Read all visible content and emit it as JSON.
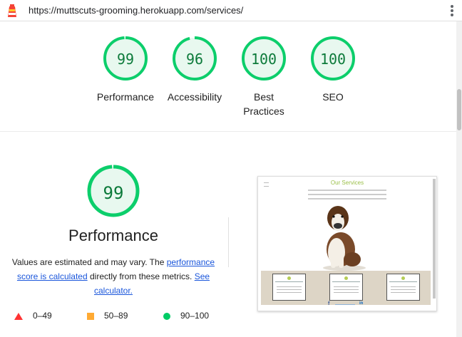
{
  "browser": {
    "url": "https://muttscuts-grooming.herokuapp.com/services/"
  },
  "colors": {
    "pass_green": "#0cce6b",
    "pass_text": "#0c7a3a",
    "pass_fill": "#e8f8ef",
    "fail_red": "#ff3333",
    "average_orange": "#ffaa33",
    "link_blue": "#1a56db"
  },
  "gauges": [
    {
      "label": "Performance",
      "score": "99",
      "value": 0.99
    },
    {
      "label": "Accessibility",
      "score": "96",
      "value": 0.96
    },
    {
      "label_line1": "Best",
      "label_line2": "Practices",
      "score": "100",
      "value": 1.0
    },
    {
      "label": "SEO",
      "score": "100",
      "value": 1.0
    }
  ],
  "performance": {
    "score": "99",
    "value": 0.99,
    "title": "Performance",
    "desc_prefix": "Values are estimated and may vary. The ",
    "desc_link1": "performance score is calculated",
    "desc_mid": " directly from these metrics. ",
    "desc_link2": "See calculator."
  },
  "legend": [
    {
      "icon": "triangle-icon",
      "range": "0–49"
    },
    {
      "icon": "square-icon",
      "range": "50–89"
    },
    {
      "icon": "circle-icon",
      "range": "90–100"
    }
  ],
  "screenshot": {
    "heading": "Our Services"
  }
}
